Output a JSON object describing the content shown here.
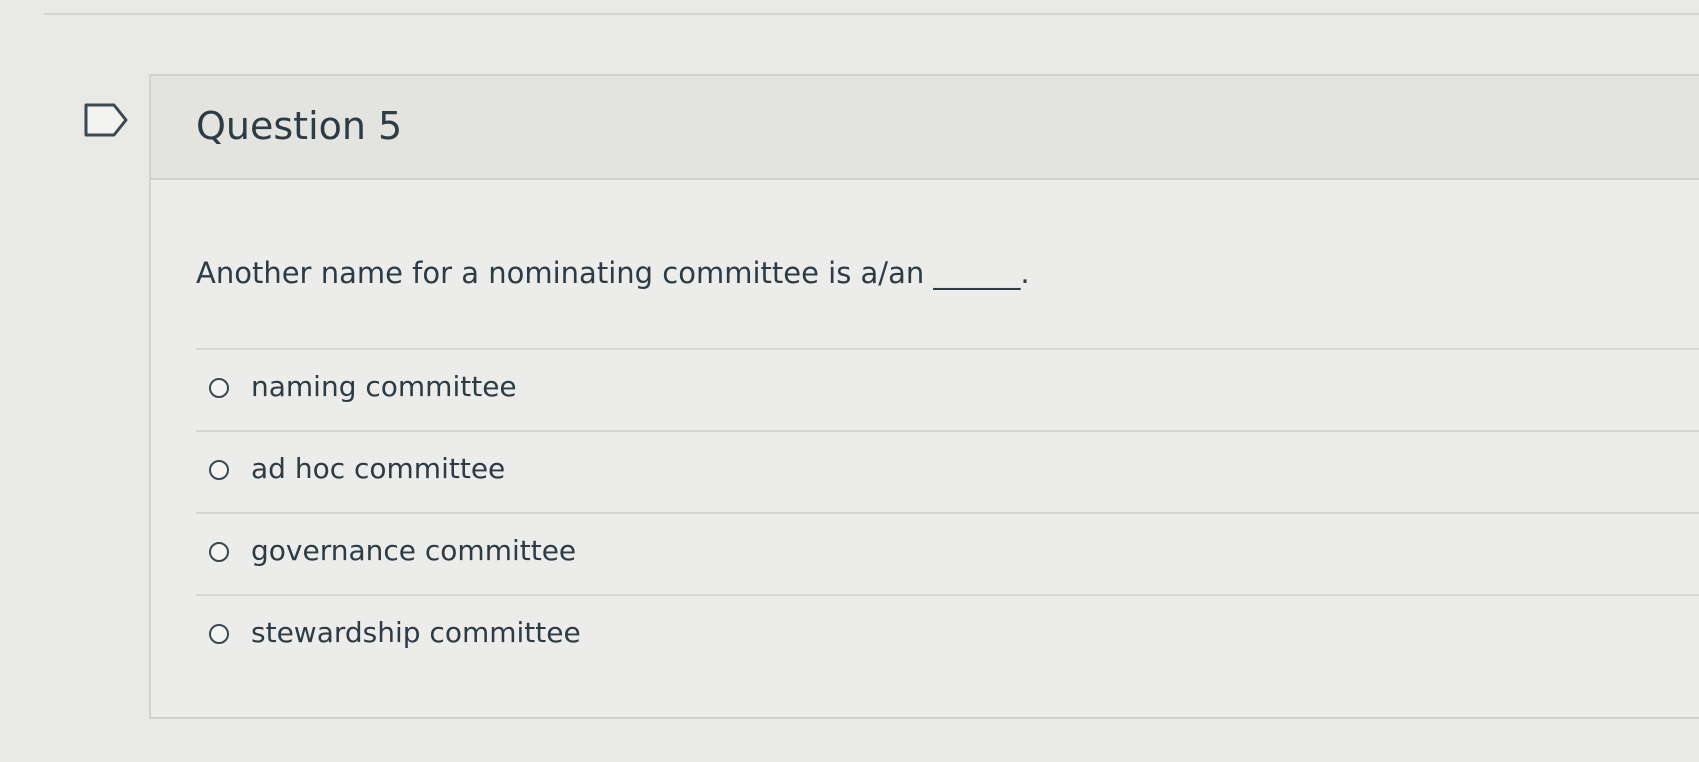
{
  "question": {
    "title": "Question 5",
    "text": "Another name for a nominating committee is a/an ______.",
    "answers": [
      {
        "label": "naming committee"
      },
      {
        "label": "ad hoc committee"
      },
      {
        "label": "governance committee"
      },
      {
        "label": "stewardship committee"
      }
    ]
  },
  "icons": {
    "flag": "flag-question-icon"
  },
  "colors": {
    "text": "#2d3b45",
    "header_background": "#e3e3e0",
    "page_background": "#e9e9e6"
  }
}
